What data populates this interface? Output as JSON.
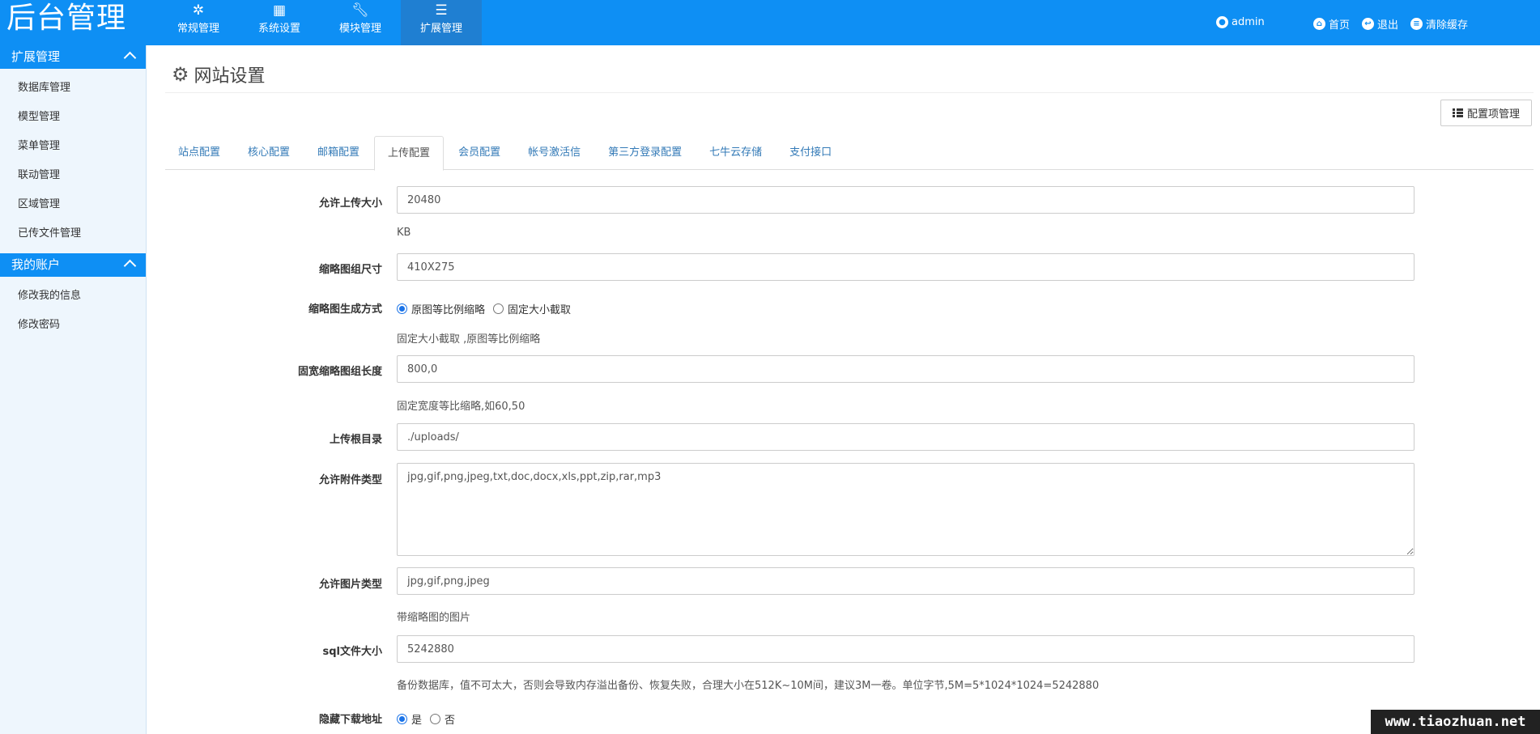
{
  "header": {
    "logo": "后台管理",
    "nav": [
      {
        "label": "常规管理",
        "icon": "snowflake-icon"
      },
      {
        "label": "系统设置",
        "icon": "grid-icon"
      },
      {
        "label": "模块管理",
        "icon": "wrench-icon"
      },
      {
        "label": "扩展管理",
        "icon": "list-icon"
      }
    ],
    "user": "admin",
    "home": "首页",
    "logout": "退出",
    "clear_cache": "清除缓存"
  },
  "sidebar": {
    "groups": [
      {
        "title": "扩展管理",
        "items": [
          "数据库管理",
          "模型管理",
          "菜单管理",
          "联动管理",
          "区域管理",
          "已传文件管理"
        ]
      },
      {
        "title": "我的账户",
        "items": [
          "修改我的信息",
          "修改密码"
        ]
      }
    ]
  },
  "main": {
    "title": "网站设置",
    "config_button": "配置项管理",
    "tabs": [
      "站点配置",
      "核心配置",
      "邮箱配置",
      "上传配置",
      "会员配置",
      "帐号激活信",
      "第三方登录配置",
      "七牛云存储",
      "支付接口"
    ],
    "active_tab": "上传配置"
  },
  "form": {
    "upload_size": {
      "label": "允许上传大小",
      "value": "20480",
      "help": "KB"
    },
    "thumb_size": {
      "label": "缩略图组尺寸",
      "value": "410X275"
    },
    "thumb_mode": {
      "label": "缩略图生成方式",
      "options": [
        "原图等比例缩略",
        "固定大小截取"
      ],
      "selected": "原图等比例缩略",
      "help": "固定大小截取 ,原图等比例缩略"
    },
    "thumb_width": {
      "label": "固宽缩略图组长度",
      "value": "800,0",
      "help": "固定宽度等比缩略,如60,50"
    },
    "upload_root": {
      "label": "上传根目录",
      "value": "./uploads/"
    },
    "attach_types": {
      "label": "允许附件类型",
      "value": "jpg,gif,png,jpeg,txt,doc,docx,xls,ppt,zip,rar,mp3"
    },
    "image_types": {
      "label": "允许图片类型",
      "value": "jpg,gif,png,jpeg",
      "help": "带缩略图的图片"
    },
    "sql_size": {
      "label": "sql文件大小",
      "value": "5242880",
      "help": "备份数据库，值不可太大，否则会导致内存溢出备份、恢复失败，合理大小在512K~10M间，建议3M一卷。单位字节,5M=5*1024*1024=5242880"
    },
    "hide_download": {
      "label": "隐藏下载地址",
      "options": [
        "是",
        "否"
      ],
      "selected": "是"
    }
  },
  "watermark": "www.tiaozhuan.net"
}
